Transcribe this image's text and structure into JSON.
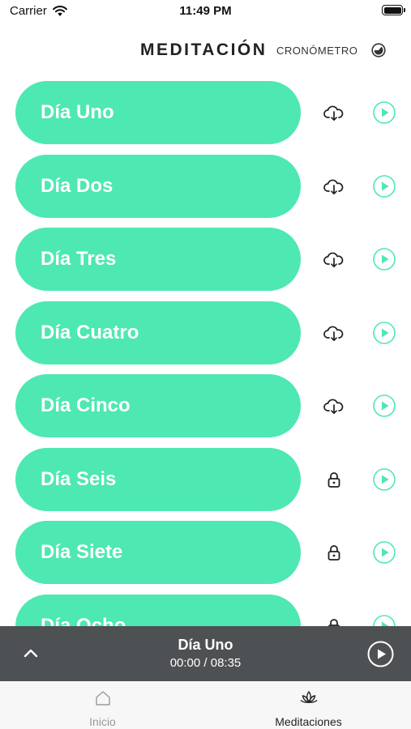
{
  "status_bar": {
    "carrier": "Carrier",
    "time": "11:49 PM"
  },
  "header": {
    "title": "MEDITACIÓN",
    "link": "CRONÓMETRO"
  },
  "colors": {
    "accent": "#4ee8b2",
    "player_bg": "#4e5154",
    "tab_inactive": "#9a9a9a",
    "tab_active": "#222222"
  },
  "meditations": [
    {
      "label": "Día Uno",
      "status_icon": "cloud-download-icon"
    },
    {
      "label": "Día Dos",
      "status_icon": "cloud-download-icon"
    },
    {
      "label": "Día Tres",
      "status_icon": "cloud-download-icon"
    },
    {
      "label": "Día Cuatro",
      "status_icon": "cloud-download-icon"
    },
    {
      "label": "Día Cinco",
      "status_icon": "cloud-download-icon"
    },
    {
      "label": "Día Seis",
      "status_icon": "lock-icon"
    },
    {
      "label": "Día Siete",
      "status_icon": "lock-icon"
    },
    {
      "label": "Día Ocho",
      "status_icon": "lock-icon"
    }
  ],
  "player": {
    "title": "Día Uno",
    "time": "00:00 / 08:35"
  },
  "tabs": [
    {
      "label": "Inicio",
      "icon": "home-icon",
      "active": false
    },
    {
      "label": "Meditaciones",
      "icon": "lotus-icon",
      "active": true
    }
  ]
}
